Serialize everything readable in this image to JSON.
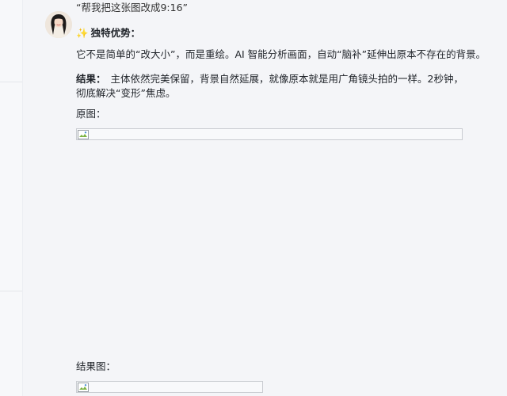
{
  "message": {
    "previous_text": "“帮我把这张图改成9:16”",
    "heading": {
      "icon": "sparkles-icon",
      "icon_glyph": "✨",
      "text": "独特优势："
    },
    "paragraph1": "它不是简单的“改大小”，而是重绘。AI 智能分析画面，自动“脑补”延伸出原本不存在的背景。",
    "paragraph2": {
      "label": "结果：",
      "text": "主体依然完美保留，背景自然延展，就像原本就是用广角镜头拍的一样。2秒钟，彻底解决“变形”焦虑。"
    },
    "original_label": "原图：",
    "result_label": "结果图：",
    "original_image_icon": "broken-image-icon",
    "result_image_icon": "broken-image-icon"
  },
  "colors": {
    "background": "#f4f5f8",
    "text": "#1f2329",
    "spark": "#f5b301",
    "placeholder_border": "#c9ccd1"
  }
}
